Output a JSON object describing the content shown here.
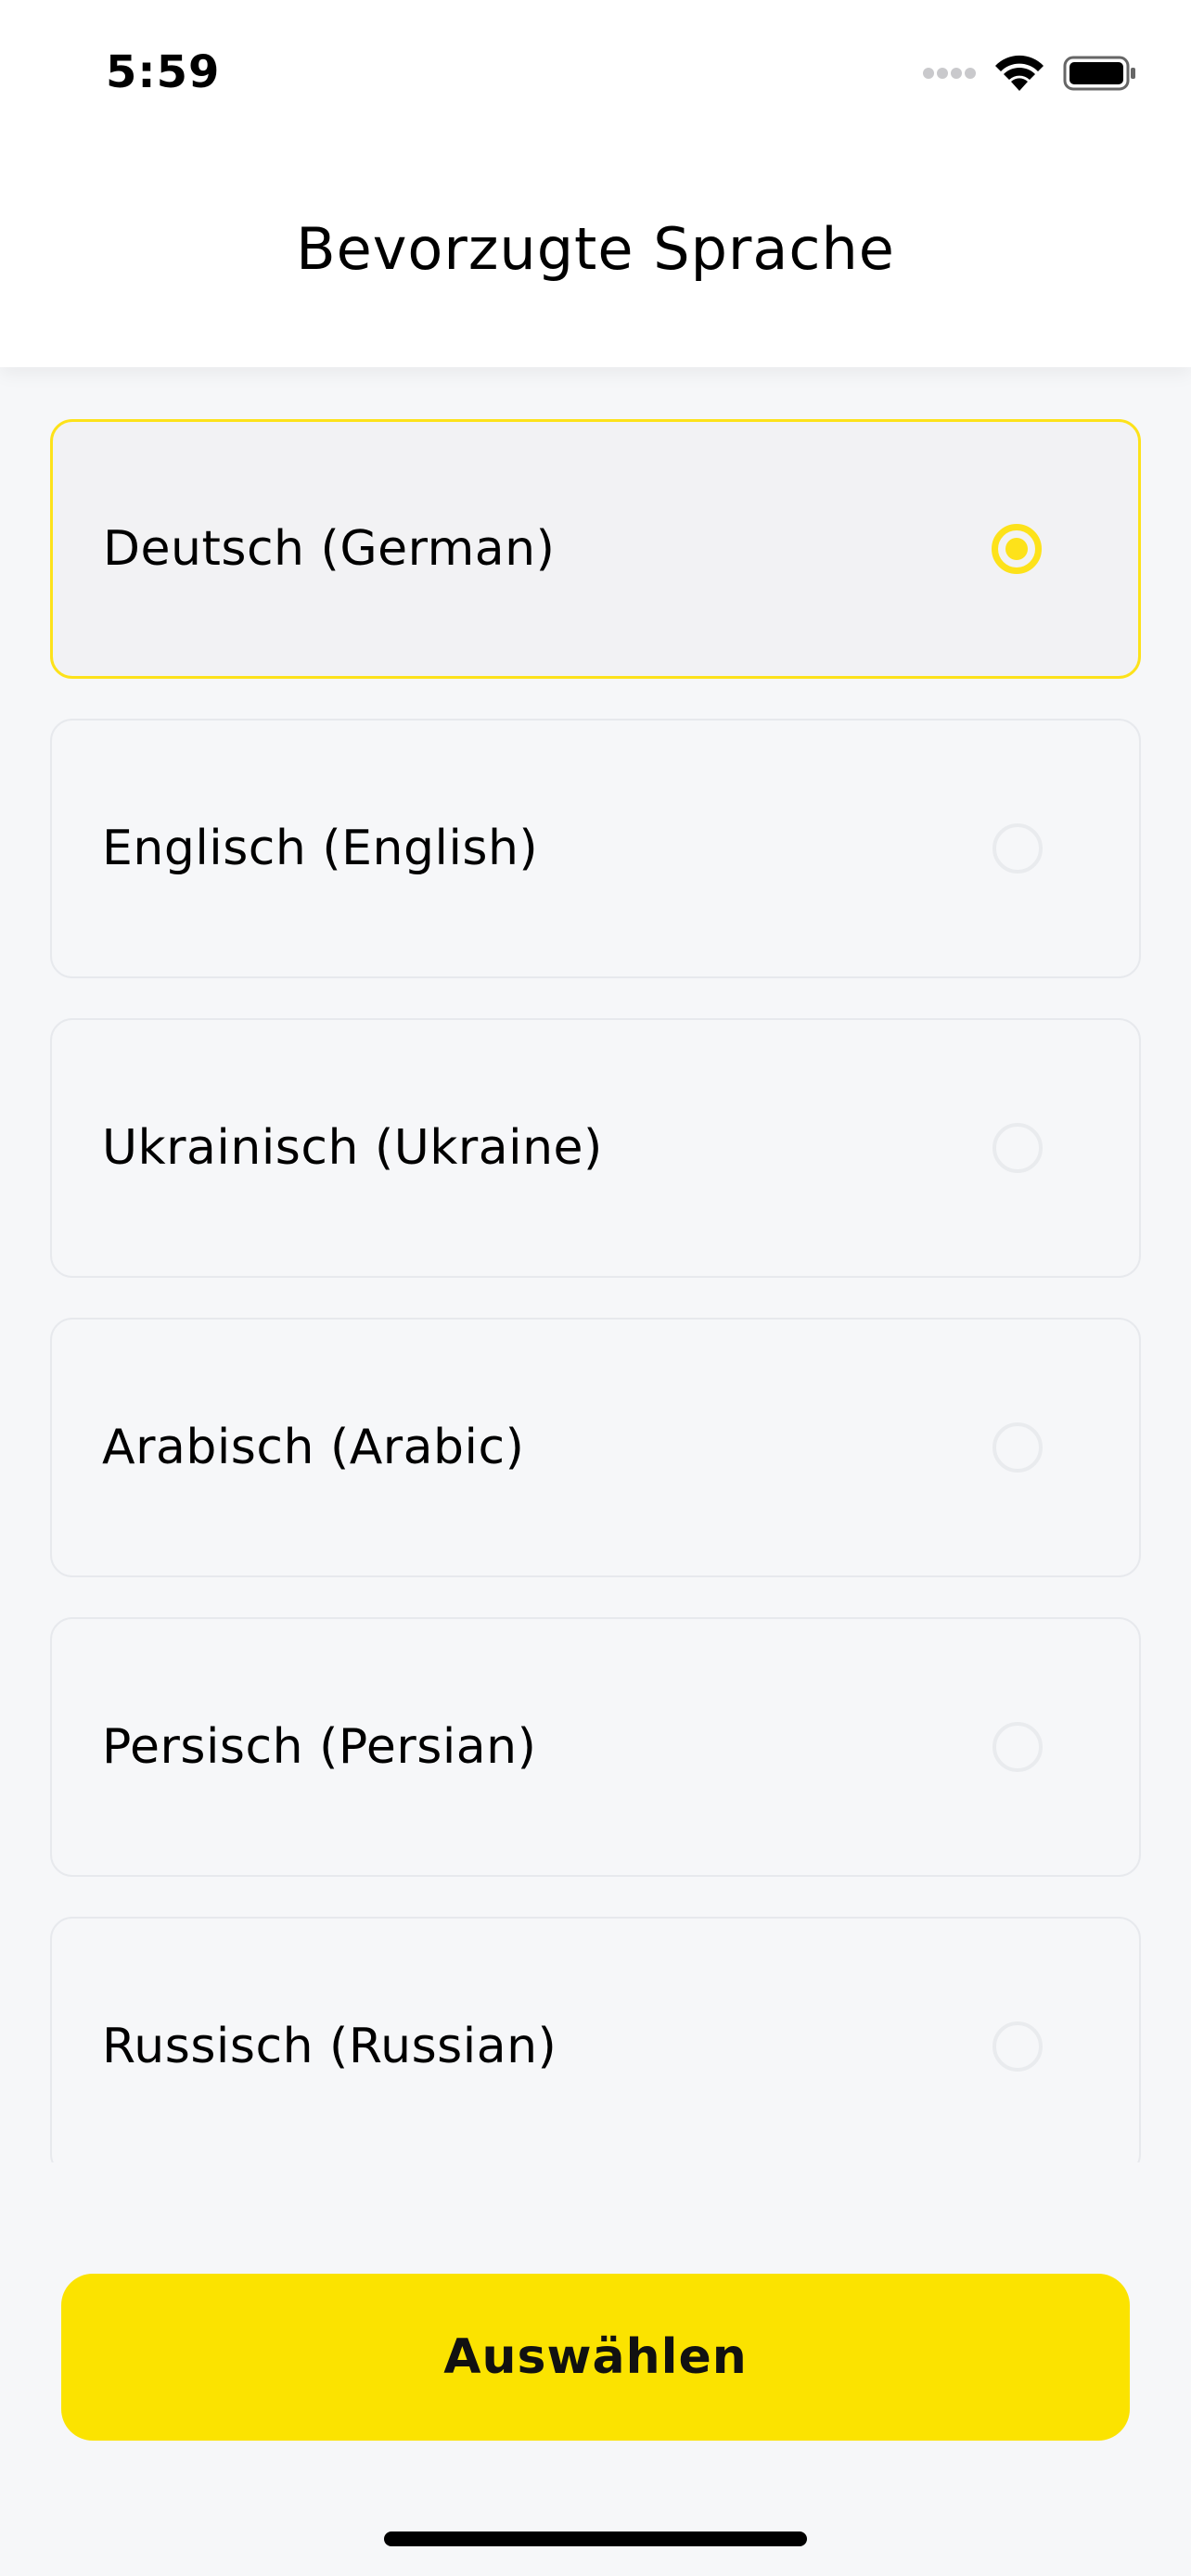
{
  "status_bar": {
    "time": "5:59",
    "icons": [
      "cellular-signal-icon",
      "wifi-icon",
      "battery-icon"
    ]
  },
  "header": {
    "title": "Bevorzugte Sprache"
  },
  "languages": [
    {
      "label": "Deutsch (German)",
      "selected": true
    },
    {
      "label": "Englisch (English)",
      "selected": false
    },
    {
      "label": "Ukrainisch (Ukraine)",
      "selected": false
    },
    {
      "label": "Arabisch (Arabic)",
      "selected": false
    },
    {
      "label": "Persisch (Persian)",
      "selected": false
    },
    {
      "label": "Russisch (Russian)",
      "selected": false
    }
  ],
  "footer": {
    "select_label": "Auswählen"
  },
  "colors": {
    "accent": "#fbe300",
    "background": "#f6f7f9",
    "border": "#e7e9ed"
  }
}
